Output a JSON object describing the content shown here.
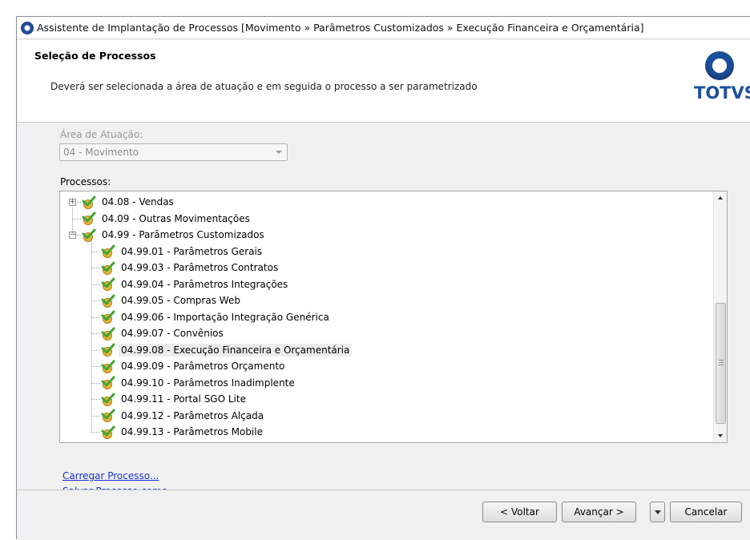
{
  "window": {
    "title": "Assistente de Implantação de Processos [Movimento » Parâmetros Customizados  » Execução Financeira e Orçamentária]"
  },
  "header": {
    "title": "Seleção de Processos",
    "description": "Deverá ser selecionada a área de atuação e em seguida o processo a ser parametrizado",
    "logo_text": "TOTVS"
  },
  "area": {
    "label": "Área de Atuação:",
    "selected": "04 - Movimento"
  },
  "processes": {
    "label": "Processos:",
    "items": [
      {
        "label": "04.08 - Vendas"
      },
      {
        "label": "04.09 - Outras Movimentações"
      },
      {
        "label": "04.99 - Parâmetros Customizados"
      },
      {
        "label": "04.99.01 - Parâmetros Gerais"
      },
      {
        "label": "04.99.03 - Parâmetros Contratos"
      },
      {
        "label": "04.99.04 - Parâmetros Integrações"
      },
      {
        "label": "04.99.05 - Compras Web"
      },
      {
        "label": "04.99.06 - Importação Integração Genérica"
      },
      {
        "label": "04.99.07 - Convênios"
      },
      {
        "label": "04.99.08 - Execução Financeira e Orçamentária"
      },
      {
        "label": "04.99.09 - Parâmetros Orçamento"
      },
      {
        "label": "04.99.10 - Parâmetros Inadimplente"
      },
      {
        "label": "04.99.11 - Portal SGO Lite"
      },
      {
        "label": "04.99.12 - Parâmetros Alçada"
      },
      {
        "label": "04.99.13 - Parâmetros Mobile"
      }
    ]
  },
  "links": {
    "load": "Carregar Processo...",
    "save": "Salvar Processo como..."
  },
  "footer": {
    "back": "< Voltar",
    "next": "Avançar >",
    "cancel": "Cancelar"
  },
  "colors": {
    "brand": "#1e4f9b",
    "link": "#1a33cc",
    "check": "#3fa535",
    "folder": "#e8b53a"
  }
}
